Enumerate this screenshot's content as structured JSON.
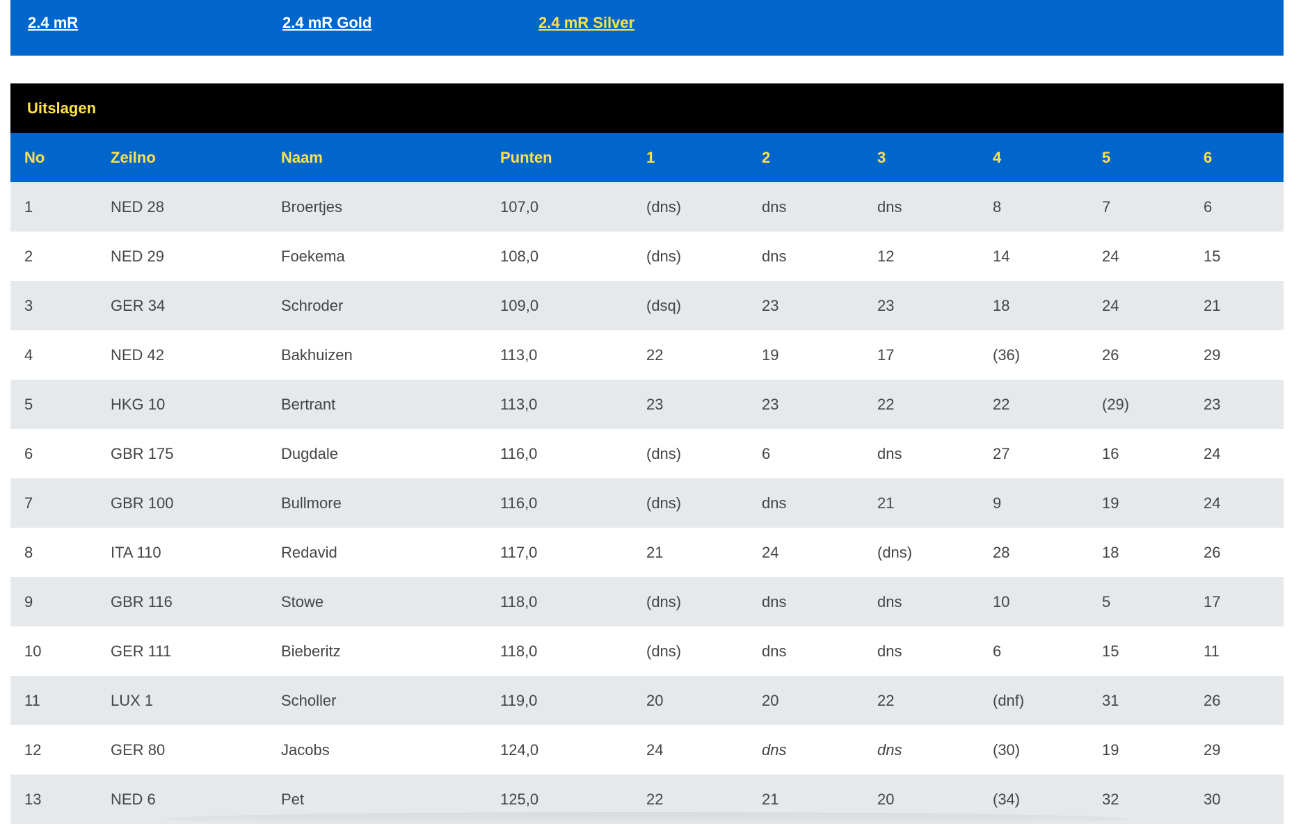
{
  "nav": {
    "links": [
      "2.4 mR",
      "2.4 mR Gold",
      "2.4 mR Silver"
    ]
  },
  "results": {
    "title": "Uitslagen",
    "columns": [
      "No",
      "Zeilno",
      "Naam",
      "Punten",
      "1",
      "2",
      "3",
      "4",
      "5",
      "6"
    ],
    "rows": [
      [
        "1",
        "NED 28",
        "Broertjes",
        "107,0",
        "(dns)",
        "dns",
        "dns",
        "8",
        "7",
        "6"
      ],
      [
        "2",
        "NED 29",
        "Foekema",
        "108,0",
        "(dns)",
        "dns",
        "12",
        "14",
        "24",
        "15"
      ],
      [
        "3",
        "GER 34",
        "Schroder",
        "109,0",
        "(dsq)",
        "23",
        "23",
        "18",
        "24",
        "21"
      ],
      [
        "4",
        "NED 42",
        "Bakhuizen",
        "113,0",
        "22",
        "19",
        "17",
        "(36)",
        "26",
        "29"
      ],
      [
        "5",
        "HKG 10",
        "Bertrant",
        "113,0",
        "23",
        "23",
        "22",
        "22",
        "(29)",
        "23"
      ],
      [
        "6",
        "GBR 175",
        "Dugdale",
        "116,0",
        "(dns)",
        "6",
        "dns",
        "27",
        "16",
        "24"
      ],
      [
        "7",
        "GBR 100",
        "Bullmore",
        "116,0",
        "(dns)",
        "dns",
        "21",
        "9",
        "19",
        "24"
      ],
      [
        "8",
        "ITA 110",
        "Redavid",
        "117,0",
        "21",
        "24",
        "(dns)",
        "28",
        "18",
        "26"
      ],
      [
        "9",
        "GBR 116",
        "Stowe",
        "118,0",
        "(dns)",
        "dns",
        "dns",
        "10",
        "5",
        "17"
      ],
      [
        "10",
        "GER 111",
        "Bieberitz",
        "118,0",
        "(dns)",
        "dns",
        "dns",
        "6",
        "15",
        "11"
      ],
      [
        "11",
        "LUX 1",
        "Scholler",
        "119,0",
        "20",
        "20",
        "22",
        "(dnf)",
        "31",
        "26"
      ],
      [
        "12",
        "GER 80",
        "Jacobs",
        "124,0",
        "24",
        "dns",
        "dns",
        "(30)",
        "19",
        "29"
      ],
      [
        "13",
        "NED 6",
        "Pet",
        "125,0",
        "22",
        "21",
        "20",
        "(34)",
        "32",
        "30"
      ]
    ]
  },
  "colors": {
    "nav_bg": "#0066cc",
    "header_text": "#ffe24a",
    "title_bg": "#000000",
    "row_alt_bg": "#e6e9ec",
    "cell_text": "#444444"
  }
}
